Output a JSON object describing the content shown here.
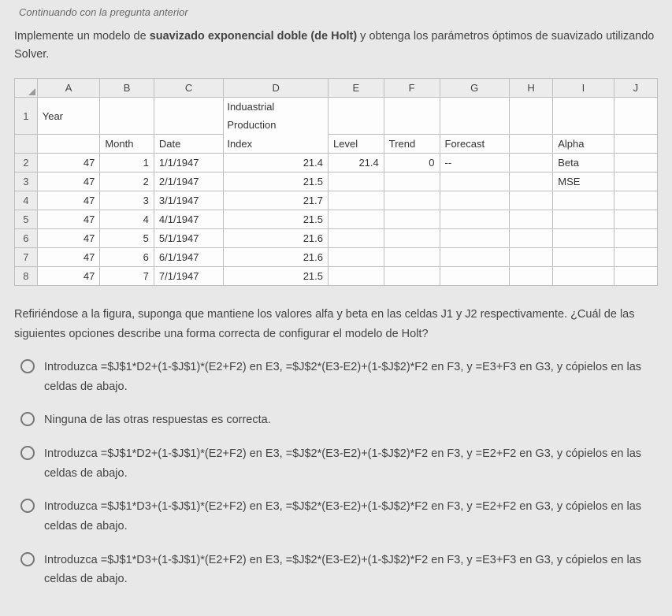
{
  "prev": "Continuando con la pregunta anterior",
  "instruction_pre": "Implemente un modelo de ",
  "instruction_bold": "suavizado exponencial doble (de Holt)",
  "instruction_post": " y obtenga los parámetros óptimos de suavizado utilizando Solver.",
  "columns": [
    "A",
    "B",
    "C",
    "D",
    "E",
    "F",
    "G",
    "H",
    "I",
    "J"
  ],
  "header_row0": {
    "A": "Year",
    "D_line1": "Induastrial",
    "D_line2": "Production"
  },
  "header_row1": {
    "B": "Month",
    "C": "Date",
    "D": "Index",
    "E": "Level",
    "F": "Trend",
    "G": "Forecast",
    "I": "Alpha"
  },
  "rows": [
    {
      "n": "2",
      "A": "47",
      "B": "1",
      "C": "1/1/1947",
      "D": "21.4",
      "E": "21.4",
      "F": "0",
      "G": "--",
      "I": "Beta"
    },
    {
      "n": "3",
      "A": "47",
      "B": "2",
      "C": "2/1/1947",
      "D": "21.5",
      "E": "",
      "F": "",
      "G": "",
      "I": "MSE"
    },
    {
      "n": "4",
      "A": "47",
      "B": "3",
      "C": "3/1/1947",
      "D": "21.7",
      "E": "",
      "F": "",
      "G": "",
      "I": ""
    },
    {
      "n": "5",
      "A": "47",
      "B": "4",
      "C": "4/1/1947",
      "D": "21.5",
      "E": "",
      "F": "",
      "G": "",
      "I": ""
    },
    {
      "n": "6",
      "A": "47",
      "B": "5",
      "C": "5/1/1947",
      "D": "21.6",
      "E": "",
      "F": "",
      "G": "",
      "I": ""
    },
    {
      "n": "7",
      "A": "47",
      "B": "6",
      "C": "6/1/1947",
      "D": "21.6",
      "E": "",
      "F": "",
      "G": "",
      "I": ""
    },
    {
      "n": "8",
      "A": "47",
      "B": "7",
      "C": "7/1/1947",
      "D": "21.5",
      "E": "",
      "F": "",
      "G": "",
      "I": ""
    }
  ],
  "question": "Refiriéndose a la figura, suponga que mantiene los valores alfa y beta en las celdas J1 y J2 respectivamente. ¿Cuál de las siguientes opciones describe una forma correcta de configurar el modelo de Holt?",
  "options": [
    "Introduzca =$J$1*D2+(1-$J$1)*(E2+F2) en E3, =$J$2*(E3-E2)+(1-$J$2)*F2 en F3, y =E3+F3 en G3, y cópielos en las celdas de abajo.",
    "Ninguna de las otras respuestas es correcta.",
    "Introduzca =$J$1*D2+(1-$J$1)*(E2+F2) en E3, =$J$2*(E3-E2)+(1-$J$2)*F2 en F3, y =E2+F2 en G3, y cópielos en las celdas de abajo.",
    "Introduzca =$J$1*D3+(1-$J$1)*(E2+F2) en E3, =$J$2*(E3-E2)+(1-$J$2)*F2 en F3, y =E2+F2 en G3, y cópielos en las celdas de abajo.",
    "Introduzca =$J$1*D3+(1-$J$1)*(E2+F2) en E3, =$J$2*(E3-E2)+(1-$J$2)*F2 en F3, y =E3+F3 en G3, y cópielos en las celdas de abajo."
  ]
}
